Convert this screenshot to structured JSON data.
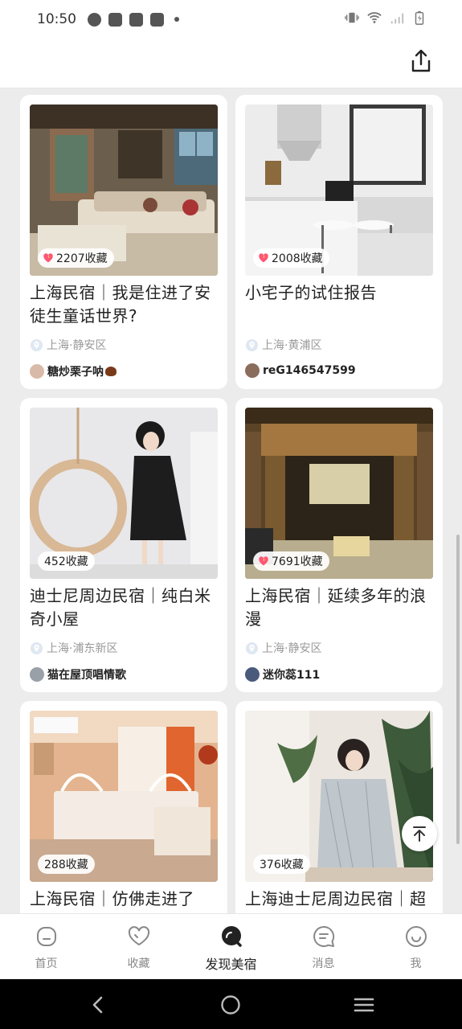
{
  "status_bar": {
    "time": "10:50",
    "left_icons": [
      "clock-app-icon",
      "mail-icon",
      "mail-icon",
      "mail-icon",
      "dot-icon"
    ],
    "right_icons": [
      "vibrate-icon",
      "wifi-icon",
      "signal-icon",
      "battery-charging-icon"
    ]
  },
  "header": {
    "share_icon": "share-icon"
  },
  "cards": [
    {
      "favorites": "2207收藏",
      "title": "上海民宿｜我是住进了安徒生童话世界?",
      "location": "上海·静安区",
      "author": "糖炒栗子呐",
      "hot": true,
      "scene": "living-room"
    },
    {
      "favorites": "2008收藏",
      "title": "小宅子的试住报告",
      "location": "上海·黄浦区",
      "author": "reG146547599",
      "hot": true,
      "scene": "kitchen"
    },
    {
      "favorites": "452收藏",
      "title": "迪士尼周边民宿｜纯白米奇小屋",
      "location": "上海·浦东新区",
      "author": "猫在屋顶唱情歌",
      "hot": false,
      "scene": "girl-swing"
    },
    {
      "favorites": "7691收藏",
      "title": "上海民宿｜延续多年的浪漫",
      "location": "上海·静安区",
      "author": "迷你蕊111",
      "hot": true,
      "scene": "library"
    },
    {
      "favorites": "288收藏",
      "title": "上海民宿｜仿佛走进了",
      "location": "",
      "author": "",
      "hot": false,
      "scene": "bedroom"
    },
    {
      "favorites": "376收藏",
      "title": "上海迪士尼周边民宿｜超",
      "location": "",
      "author": "",
      "hot": false,
      "scene": "girl-plant"
    }
  ],
  "bottom_nav": [
    {
      "label": "首页",
      "icon": "home-icon",
      "active": false
    },
    {
      "label": "收藏",
      "icon": "heart-icon",
      "active": false
    },
    {
      "label": "发现美宿",
      "icon": "discover-icon",
      "active": true
    },
    {
      "label": "消息",
      "icon": "message-icon",
      "active": false
    },
    {
      "label": "我",
      "icon": "profile-icon",
      "active": false
    }
  ],
  "colors": {
    "accent_pink": "#ff5577",
    "background": "#ececec",
    "card": "#ffffff"
  }
}
